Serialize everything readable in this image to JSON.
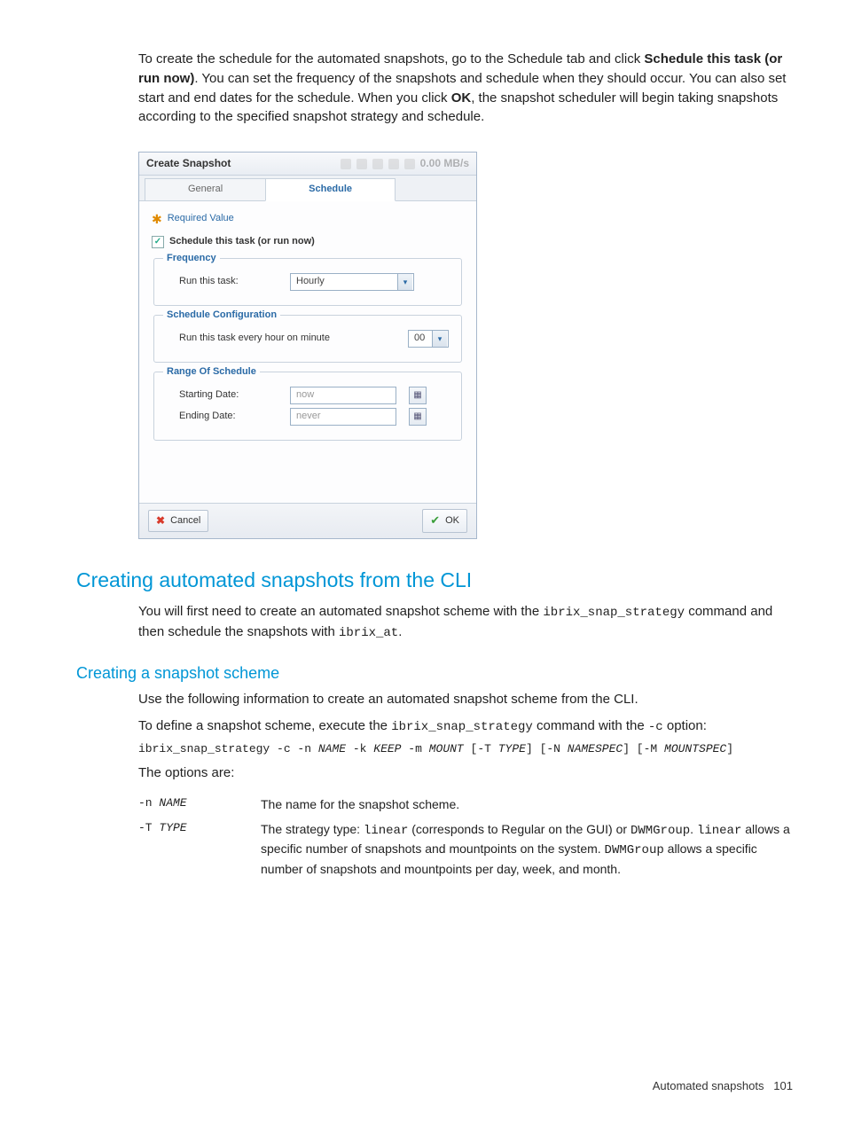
{
  "intro": {
    "t1": "To create the schedule for the automated snapshots, go to the Schedule tab and click ",
    "bold1": "Schedule this task (or run now)",
    "t2": ". You can set the frequency of the snapshots and schedule when they should occur. You can also set start and end dates for the schedule. When you click ",
    "bold2": "OK",
    "t3": ", the snapshot scheduler will begin taking snapshots according to the specified snapshot strategy and schedule."
  },
  "dialog": {
    "title": "Create Snapshot",
    "rate": "0.00 MB/s",
    "tabs": {
      "general": "General",
      "schedule": "Schedule"
    },
    "required": "Required Value",
    "checkbox_label": "Schedule this task (or run now)",
    "frequency": {
      "legend": "Frequency",
      "run_label": "Run this task:",
      "value": "Hourly"
    },
    "config": {
      "legend": "Schedule Configuration",
      "label": "Run this task every hour on minute",
      "value": "00"
    },
    "range": {
      "legend": "Range Of Schedule",
      "start_label": "Starting Date:",
      "start_value": "now",
      "end_label": "Ending Date:",
      "end_value": "never"
    },
    "buttons": {
      "cancel": "Cancel",
      "ok": "OK"
    }
  },
  "sec1": {
    "heading": "Creating automated snapshots from the CLI",
    "p1a": "You will first need to create an automated snapshot scheme with the ",
    "code1": "ibrix_snap_strategy",
    "p1b": " command and then schedule the snapshots with ",
    "code2": "ibrix_at",
    "p1c": "."
  },
  "sec2": {
    "heading": "Creating a snapshot scheme",
    "p1": "Use the following information to create an automated snapshot scheme from the CLI.",
    "p2a": "To define a snapshot scheme, execute the ",
    "code1": "ibrix_snap_strategy",
    "p2b": " command with the ",
    "code2": "-c",
    "p2c": " option:",
    "cmd": {
      "a": "ibrix_snap_strategy -c -n ",
      "i1": "NAME",
      "b": " -k ",
      "i2": "KEEP",
      "c": " -m ",
      "i3": "MOUNT",
      "d": " [-T ",
      "i4": "TYPE",
      "e": "] [-N ",
      "i5": "NAMESPEC",
      "f": "] [-M ",
      "i6": "MOUNTSPEC",
      "g": "]"
    },
    "opts_intro": "The options are:",
    "opt_n": {
      "flag": "-n ",
      "arg": "NAME",
      "desc": "The name for the snapshot scheme."
    },
    "opt_t": {
      "flag": "-T ",
      "arg": "TYPE",
      "d1": "The strategy type: ",
      "m1": "linear",
      "d2": " (corresponds to Regular on the GUI) or ",
      "m2": "DWMGroup",
      "d3": ". ",
      "m3": "linear",
      "d4": " allows a specific number of snapshots and mountpoints on the system. ",
      "m4": "DWMGroup",
      "d5": " allows a specific number of snapshots and mountpoints per day, week, and month."
    }
  },
  "footer": {
    "label": "Automated snapshots",
    "page": "101"
  }
}
